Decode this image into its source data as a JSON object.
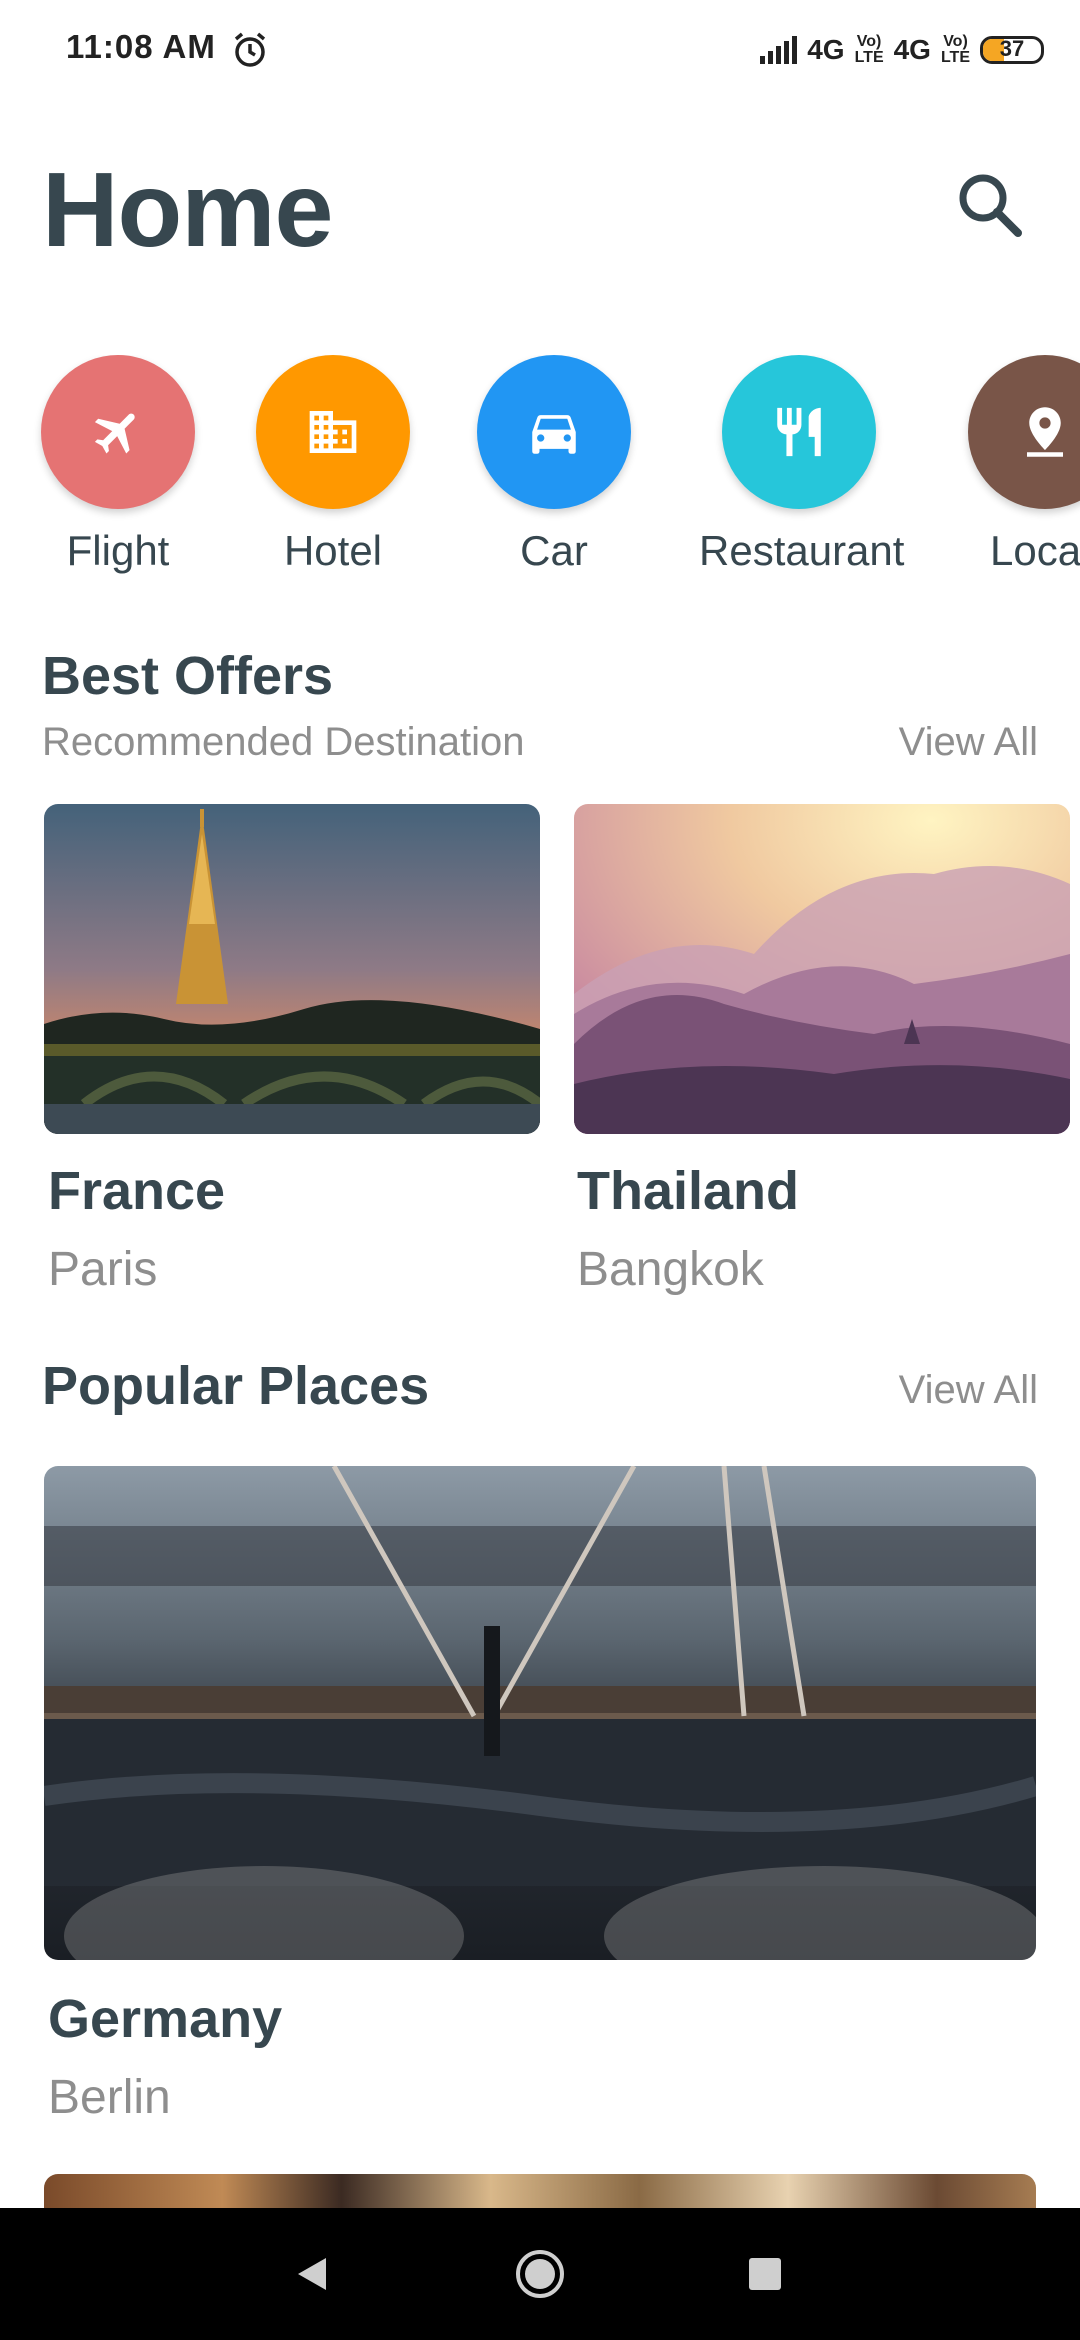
{
  "status_bar": {
    "time": "11:08 AM",
    "net1": "4G",
    "volte_line1": "Vo)",
    "volte_line2": "LTE",
    "net2": "4G",
    "battery": "37",
    "battery_level": 0.37
  },
  "header": {
    "title": "Home",
    "search_icon": "search-icon"
  },
  "categories": [
    {
      "label": "Flight",
      "icon": "airplane-icon",
      "color": "#e57373"
    },
    {
      "label": "Hotel",
      "icon": "building-icon",
      "color": "#ff9800"
    },
    {
      "label": "Car",
      "icon": "car-icon",
      "color": "#2196f3"
    },
    {
      "label": "Restaurant",
      "icon": "fork-knife-icon",
      "color": "#26c6da"
    },
    {
      "label": "Loca",
      "icon": "location-pin-icon",
      "color": "#795548"
    }
  ],
  "best_offers": {
    "title": "Best Offers",
    "subtitle": "Recommended Destination",
    "view_all": "View All",
    "items": [
      {
        "country": "France",
        "city": "Paris"
      },
      {
        "country": "Thailand",
        "city": "Bangkok"
      }
    ]
  },
  "popular_places": {
    "title": "Popular Places",
    "view_all": "View All",
    "items": [
      {
        "country": "Germany",
        "city": "Berlin"
      }
    ]
  },
  "nav": {
    "back_icon": "back-triangle-icon",
    "home_icon": "home-circle-icon",
    "recents_icon": "recents-square-icon"
  }
}
